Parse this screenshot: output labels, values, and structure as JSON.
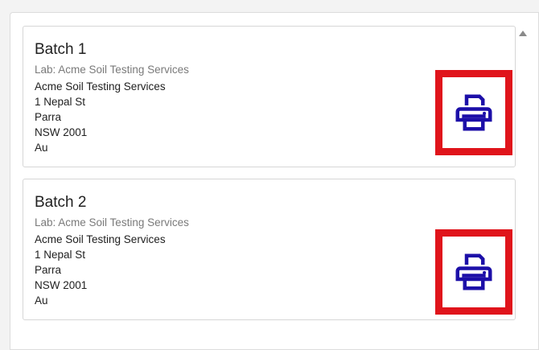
{
  "batches": [
    {
      "title": "Batch 1",
      "lab_label": "Lab: Acme Soil Testing Services",
      "address": [
        "Acme Soil Testing Services",
        "1 Nepal St",
        "Parra",
        "NSW 2001",
        "Au"
      ],
      "print_icon": "printer-icon"
    },
    {
      "title": "Batch 2",
      "lab_label": "Lab: Acme Soil Testing Services",
      "address": [
        "Acme Soil Testing Services",
        "1 Nepal St",
        "Parra",
        "NSW 2001",
        "Au"
      ],
      "print_icon": "printer-icon"
    }
  ],
  "colors": {
    "icon": "#1c0fa8",
    "highlight_border": "#e0141b",
    "card_border": "#d6d6d6",
    "muted_text": "#7a7a7a"
  }
}
